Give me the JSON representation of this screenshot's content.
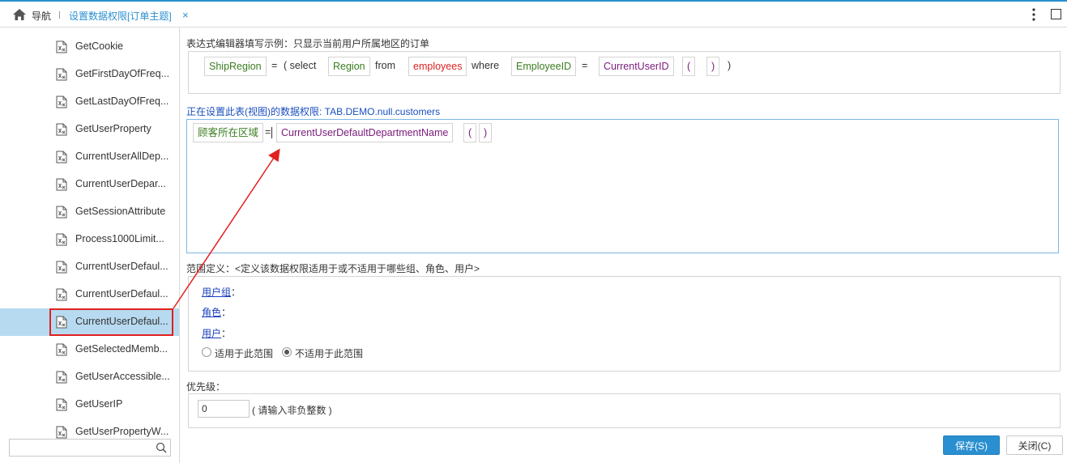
{
  "topbar": {
    "nav_label": "导航",
    "tab_title": "设置数据权限[订单主题]",
    "tab_close": "×"
  },
  "sidebar": {
    "items": [
      {
        "label": "GetCookie"
      },
      {
        "label": "GetFirstDayOfFreq..."
      },
      {
        "label": "GetLastDayOfFreq..."
      },
      {
        "label": "GetUserProperty"
      },
      {
        "label": "CurrentUserAllDep..."
      },
      {
        "label": "CurrentUserDepar..."
      },
      {
        "label": "GetSessionAttribute"
      },
      {
        "label": "Process1000Limit..."
      },
      {
        "label": "CurrentUserDefaul..."
      },
      {
        "label": "CurrentUserDefaul..."
      },
      {
        "label": "CurrentUserDefaul...",
        "selected": true
      },
      {
        "label": "GetSelectedMemb..."
      },
      {
        "label": "GetUserAccessible..."
      },
      {
        "label": "GetUserIP"
      },
      {
        "label": "GetUserPropertyW..."
      }
    ],
    "search_placeholder": ""
  },
  "example": {
    "label": "表达式编辑器填写示例：只显示当前用户所属地区的订单",
    "tokens": {
      "ship_region": "ShipRegion",
      "eq1": "=",
      "open_select": "( select",
      "region": "Region",
      "from": "from",
      "employees": "employees",
      "where": "where",
      "employee_id": "EmployeeID",
      "eq2": "=",
      "current_user_id": "CurrentUserID",
      "lparen": "(",
      "rparen": ")",
      "close": ")"
    }
  },
  "editor": {
    "label_prefix": "正在设置此表(视图)的数据权限: ",
    "table_name": "TAB.DEMO.null.customers",
    "tokens": {
      "field": "顾客所在区域",
      "eq": "=",
      "func": "CurrentUserDefaultDepartmentName",
      "lparen": "(",
      "rparen": ")"
    }
  },
  "scope": {
    "label": "范围定义：<定义该数据权限适用于或不适用于哪些组、角色、用户>",
    "user_group": "用户组",
    "role": "角色",
    "user": "用户",
    "colon": "：",
    "radio_apply": "适用于此范围",
    "radio_not_apply": "不适用于此范围",
    "selected": "not_apply"
  },
  "priority": {
    "label": "优先级：",
    "value": "0",
    "hint": "( 请输入非负整数 )"
  },
  "buttons": {
    "save": "保存(S)",
    "close": "关闭(C)"
  },
  "colors": {
    "accent": "#2a8fd0",
    "selected_row": "#b7daf0",
    "highlight_red": "#e02020",
    "field_green": "#3a7d1f",
    "table_red": "#d22222",
    "function_purple": "#7a1a7a",
    "path_blue": "#1a4fbf"
  }
}
